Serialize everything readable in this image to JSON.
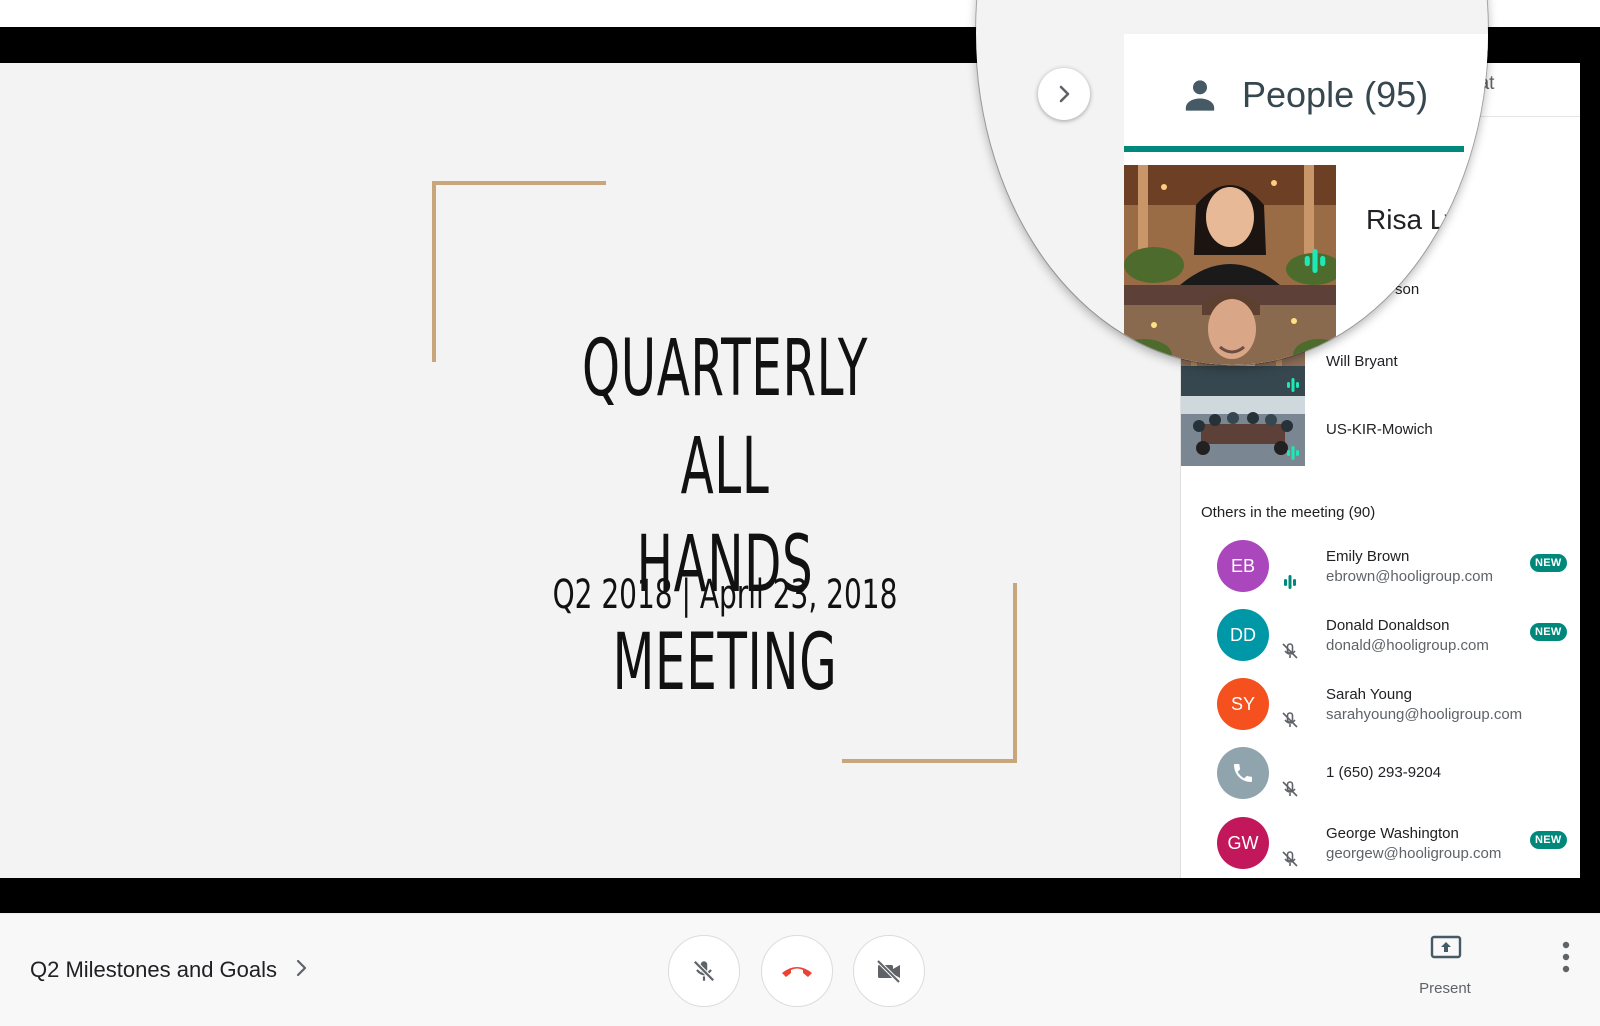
{
  "slide": {
    "title_line1": "QUARTERLY ALL",
    "title_line2": "HANDS MEETING",
    "subtitle": "Q2 2018 | April 23, 2018"
  },
  "people_panel": {
    "tab_people_label": "People (95)",
    "tab_chat_partial": "hat",
    "featured_name_partial": "Risa Ly",
    "second_name_partial": "son",
    "participants": [
      {
        "name": "Will Bryant",
        "speaking": true
      },
      {
        "name": "US-KIR-Mowich",
        "speaking": true
      }
    ],
    "others_header": "Others in the meeting (90)",
    "others": [
      {
        "initials": "EB",
        "name": "Emily Brown",
        "email": "ebrown@hooligroup.com",
        "color": "#ab47bc",
        "status": "speaking",
        "badge": "NEW"
      },
      {
        "initials": "DD",
        "name": "Donald Donaldson",
        "email": "donald@hooligroup.com",
        "color": "#0097a7",
        "status": "muted",
        "badge": "NEW"
      },
      {
        "initials": "SY",
        "name": "Sarah Young",
        "email": "sarahyoung@hooligroup.com",
        "color": "#f4511e",
        "status": "muted",
        "badge": ""
      },
      {
        "initials": "",
        "name": "1 (650) 293-9204",
        "email": "",
        "color": "#90a4ae",
        "status": "muted",
        "badge": "",
        "icon": "phone-icon"
      },
      {
        "initials": "GW",
        "name": "George Washington",
        "email": "georgew@hooligroup.com",
        "color": "#c2185b",
        "status": "muted",
        "badge": "NEW"
      }
    ]
  },
  "toolbar": {
    "meeting_title": "Q2 Milestones and Goals",
    "present_label": "Present",
    "icons": [
      "mic-off-icon",
      "hang-up-icon",
      "camera-off-icon",
      "present-screen-icon",
      "more-vert-icon"
    ]
  },
  "colors": {
    "accent_teal": "#00897b",
    "speaking_green": "#1de9b6",
    "bracket_gold": "#c9a57c",
    "hangup_red": "#ea4335"
  }
}
